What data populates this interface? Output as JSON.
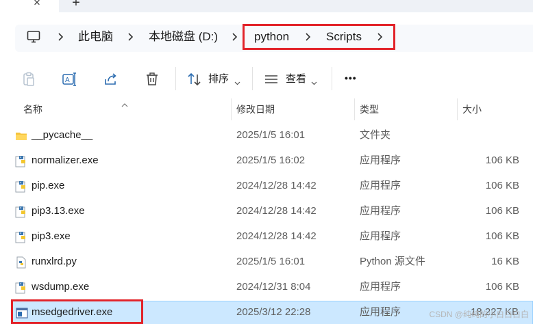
{
  "tabs": {
    "close_glyph": "×",
    "new_tab_glyph": "+"
  },
  "address": {
    "computer_icon": "computer-icon",
    "crumbs": [
      "此电脑",
      "本地磁盘 (D:)",
      "python",
      "Scripts"
    ],
    "highlight_color": "#e2232a"
  },
  "toolbar": {
    "sort_label": "排序",
    "view_label": "查看",
    "more_label": "•••",
    "icons": [
      "paste-icon",
      "rename-icon",
      "share-icon",
      "delete-icon",
      "sort-icon",
      "view-icon"
    ]
  },
  "columns": {
    "name": "名称",
    "date": "修改日期",
    "type": "类型",
    "size": "大小"
  },
  "files": [
    {
      "name": "__pycache__",
      "date": "2025/1/5 16:01",
      "type": "文件夹",
      "size": "",
      "icon": "folder-icon"
    },
    {
      "name": "normalizer.exe",
      "date": "2025/1/5 16:02",
      "type": "应用程序",
      "size": "106 KB",
      "icon": "python-exe-icon"
    },
    {
      "name": "pip.exe",
      "date": "2024/12/28 14:42",
      "type": "应用程序",
      "size": "106 KB",
      "icon": "python-exe-icon"
    },
    {
      "name": "pip3.13.exe",
      "date": "2024/12/28 14:42",
      "type": "应用程序",
      "size": "106 KB",
      "icon": "python-exe-icon"
    },
    {
      "name": "pip3.exe",
      "date": "2024/12/28 14:42",
      "type": "应用程序",
      "size": "106 KB",
      "icon": "python-exe-icon"
    },
    {
      "name": "runxlrd.py",
      "date": "2025/1/5 16:01",
      "type": "Python 源文件",
      "size": "16 KB",
      "icon": "python-file-icon"
    },
    {
      "name": "wsdump.exe",
      "date": "2024/12/31 8:04",
      "type": "应用程序",
      "size": "106 KB",
      "icon": "python-exe-icon"
    },
    {
      "name": "msedgedriver.exe",
      "date": "2025/3/12 22:28",
      "type": "应用程序",
      "size": "18,227 KB",
      "icon": "app-window-icon",
      "selected": true
    }
  ],
  "watermark": "CSDN @纯纯的小白白白白"
}
